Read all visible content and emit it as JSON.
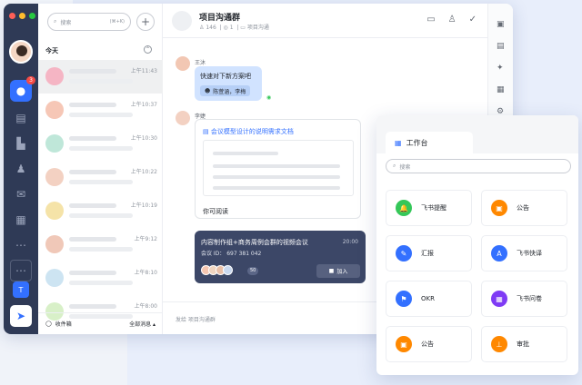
{
  "search": {
    "placeholder": "搜索",
    "shortcut": "(⌘+K)"
  },
  "list": {
    "section_today": "今天",
    "chats": [
      {
        "time": "上午11:43",
        "color": "#f5b5c4"
      },
      {
        "time": "上午10:37",
        "color": "#f6c7b6"
      },
      {
        "time": "上午10:30",
        "color": "#bfe7d9"
      },
      {
        "time": "上午10:22",
        "color": "#f3d1c2"
      },
      {
        "time": "上午10:19",
        "color": "#f5e3a8"
      },
      {
        "time": "上午9:12",
        "color": "#f0c8b8"
      },
      {
        "time": "上午8:10",
        "color": "#cde4f2"
      },
      {
        "time": "上午8:00",
        "color": "#d8f0c8"
      }
    ],
    "footer_left": "收件箱",
    "footer_right": "全部消息 ▴"
  },
  "rail": {
    "badge": "3",
    "team_letter": "T"
  },
  "chat": {
    "title": "项目沟通群",
    "members": "146",
    "online": "1",
    "org": "项目沟通",
    "msg1_sender": "王沐",
    "msg1_text": "快速对下新方案吧",
    "msg1_mention": "陈萱涵，李梅",
    "msg2_sender": "李婕",
    "doc_title": "会议模型设计的说明需求文档",
    "doc_desc": "你可阅读",
    "meeting_title": "内容制作组+商务周例会群的视频会议",
    "meeting_time": "20:00",
    "meeting_id": "会议 ID： 697 381 042",
    "meeting_count": "50",
    "meeting_join": "加入",
    "composer_placeholder": "发给 项目沟通群"
  },
  "workbench": {
    "tab": "工作台",
    "search_placeholder": "搜索",
    "apps": [
      {
        "label": "飞书提醒",
        "color": "#34c759",
        "icon": "bell-icon",
        "glyph": "🔔"
      },
      {
        "label": "公告",
        "color": "#ff8800",
        "icon": "notice-icon",
        "glyph": "▣"
      },
      {
        "label": "汇报",
        "color": "#3370ff",
        "icon": "pen-icon",
        "glyph": "✎"
      },
      {
        "label": "飞书快译",
        "color": "#3370ff",
        "icon": "translate-icon",
        "glyph": "A"
      },
      {
        "label": "OKR",
        "color": "#3370ff",
        "icon": "flag-icon",
        "glyph": "⚑"
      },
      {
        "label": "飞书问卷",
        "color": "#7f3bf5",
        "icon": "qr-icon",
        "glyph": "▦"
      },
      {
        "label": "公告",
        "color": "#ff8800",
        "icon": "notice-icon",
        "glyph": "▣"
      },
      {
        "label": "审批",
        "color": "#ff8800",
        "icon": "stamp-icon",
        "glyph": "⊥"
      }
    ]
  }
}
